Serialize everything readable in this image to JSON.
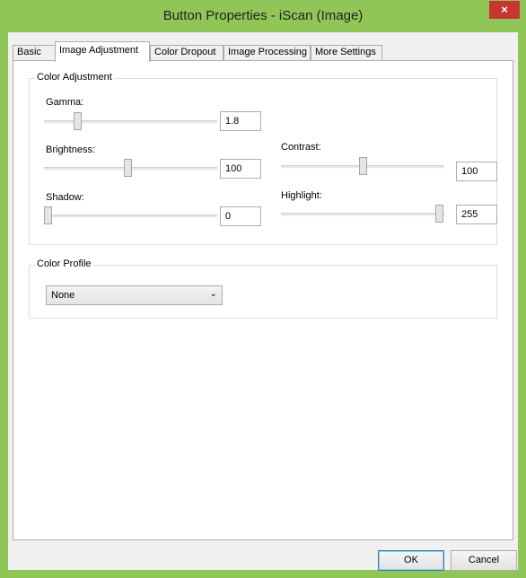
{
  "window": {
    "title": "Button Properties - iScan (Image)",
    "close_glyph": "×"
  },
  "tabs": [
    {
      "label": "Basic"
    },
    {
      "label": "Image Adjustment",
      "active": true
    },
    {
      "label": "Color Dropout"
    },
    {
      "label": "Image Processing"
    },
    {
      "label": "More Settings"
    }
  ],
  "color_adjustment": {
    "legend": "Color Adjustment",
    "gamma": {
      "label": "Gamma:",
      "value": "1.8"
    },
    "brightness": {
      "label": "Brightness:",
      "value": "100"
    },
    "contrast": {
      "label": "Contrast:",
      "value": "100"
    },
    "shadow": {
      "label": "Shadow:",
      "value": "0"
    },
    "highlight": {
      "label": "Highlight:",
      "value": "255"
    }
  },
  "color_profile": {
    "legend": "Color Profile",
    "selected": "None"
  },
  "buttons": {
    "ok": "OK",
    "cancel": "Cancel"
  }
}
